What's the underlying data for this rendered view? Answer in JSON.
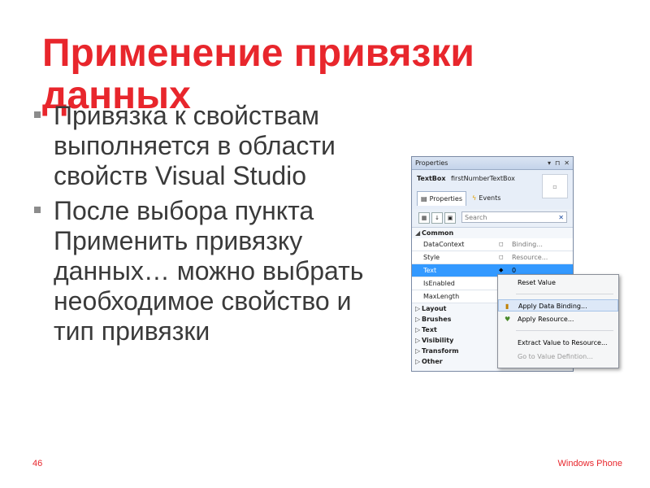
{
  "slide": {
    "title": "Применение привязки данных",
    "bullets": [
      "Привязка к свойствам выполняется в области свойств Visual Studio",
      "После выбора пункта Применить  привязку данных… можно выбрать необходимое свойство и тип привязки"
    ],
    "page_number": "46",
    "brand": "Windows Phone"
  },
  "properties_panel": {
    "title": "Properties",
    "titlebar_buttons": [
      "▾",
      "⊓",
      "✕"
    ],
    "control_type": "TextBox",
    "control_name": "firstNumberTextBox",
    "tabs": [
      "Properties",
      "Events"
    ],
    "search_placeholder": "Search",
    "search_clear": "✕",
    "common_category": "Common",
    "rows": [
      {
        "name": "DataContext",
        "marker": "◻",
        "value": "Binding..."
      },
      {
        "name": "Style",
        "marker": "◻",
        "value": "Resource..."
      },
      {
        "name": "Text",
        "marker": "◆",
        "value": "0"
      },
      {
        "name": "IsEnabled",
        "marker": "",
        "value": ""
      },
      {
        "name": "MaxLength",
        "marker": "",
        "value": ""
      }
    ],
    "categories": [
      "Layout",
      "Brushes",
      "Text",
      "Visibility",
      "Transform",
      "Other"
    ]
  },
  "context_menu": {
    "items": [
      "Reset Value",
      "Apply Data Binding...",
      "Apply Resource...",
      "Extract Value to Resource...",
      "Go to Value Defintion..."
    ]
  },
  "colors": {
    "title": "#e8262c",
    "body_text": "#3a3a3a",
    "selection": "#3399ff"
  }
}
